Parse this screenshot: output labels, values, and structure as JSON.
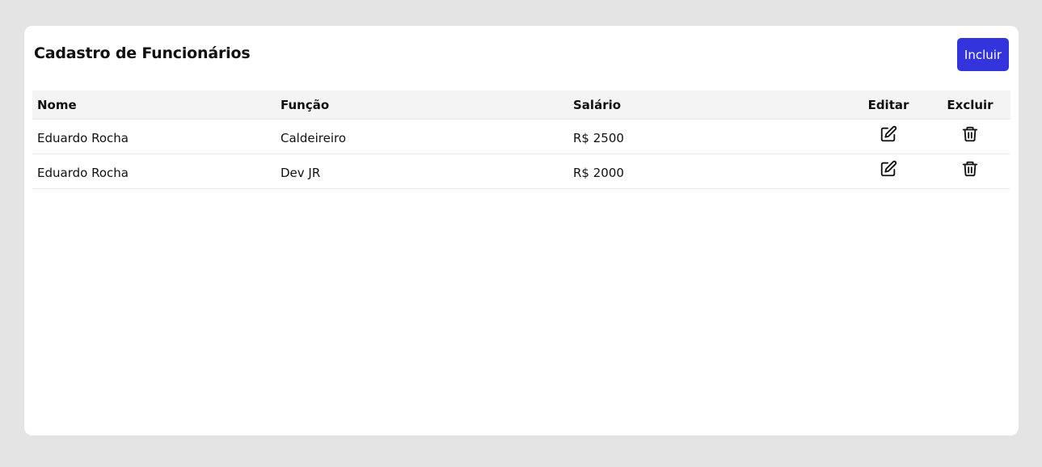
{
  "header": {
    "title": "Cadastro de Funcionários",
    "add_label": "Incluir",
    "add_color": "#3434dc"
  },
  "table": {
    "columns": [
      "Nome",
      "Função",
      "Salário",
      "Editar",
      "Excluir"
    ],
    "rows": [
      {
        "nome": "Eduardo Rocha",
        "funcao": "Caldeireiro",
        "salario": "R$ 2500",
        "edit_icon": "edit-icon",
        "delete_icon": "trash-icon"
      },
      {
        "nome": "Eduardo Rocha",
        "funcao": "Dev JR",
        "salario": "R$ 2000",
        "edit_icon": "edit-icon",
        "delete_icon": "trash-icon"
      }
    ]
  }
}
